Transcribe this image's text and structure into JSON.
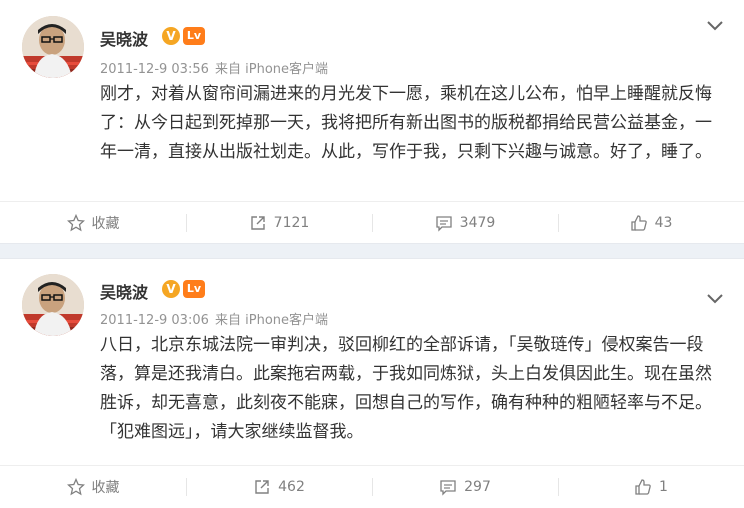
{
  "posts": [
    {
      "author": "吴晓波",
      "verified_badge": "V",
      "level_badge": "Lv",
      "time": "2011-12-9 03:56",
      "source": "来自 iPhone客户端",
      "text": "刚才，对着从窗帘间漏进来的月光发下一愿，乘机在这儿公布，怕早上睡醒就反悔了：从今日起到死掉那一天，我将把所有新出图书的版税都捐给民营公益基金，一年一清，直接从出版社划走。从此，写作于我，只剩下兴趣与诚意。好了，睡了。",
      "actions": {
        "favorite_label": "收藏",
        "repost_count": "7121",
        "comment_count": "3479",
        "like_count": "43"
      }
    },
    {
      "author": "吴晓波",
      "verified_badge": "V",
      "level_badge": "Lv",
      "time": "2011-12-9 03:06",
      "source": "来自 iPhone客户端",
      "text": "八日，北京东城法院一审判决，驳回柳红的全部诉请，「吴敬琏传」侵权案告一段落，算是还我清白。此案拖宕两载，于我如同炼狱，头上白发俱因此生。现在虽然胜诉，却无喜意，此刻夜不能寐，回想自己的写作，确有种种的粗陋轻率与不足。「犯难图远」，请大家继续监督我。",
      "actions": {
        "favorite_label": "收藏",
        "repost_count": "462",
        "comment_count": "297",
        "like_count": "1"
      }
    }
  ],
  "icons": {
    "favorite": "star-icon",
    "repost": "share-arrow-icon",
    "comment": "comment-bubble-icon",
    "like": "thumbs-up-icon",
    "menu": "chevron-down-icon"
  },
  "colors": {
    "text": "#333333",
    "meta": "#939393",
    "action": "#808080",
    "verified": "#f5a623",
    "level": "#ff7d1a",
    "separator": "#edf1f6"
  }
}
